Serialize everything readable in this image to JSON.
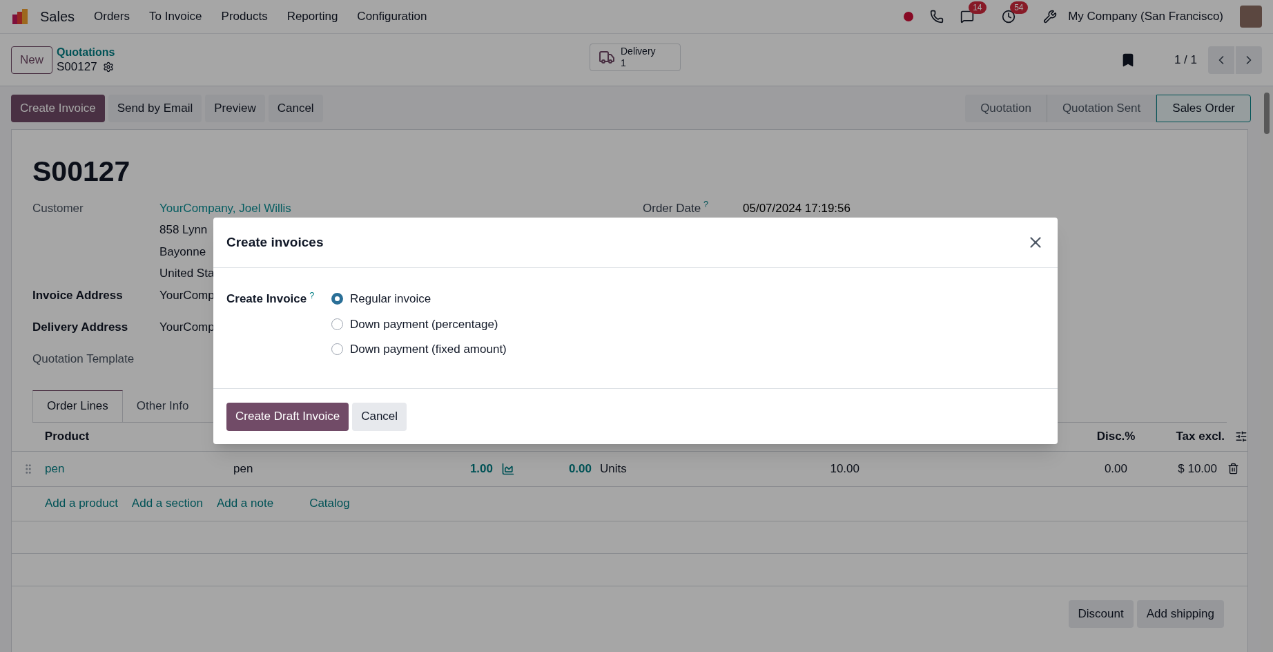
{
  "navbar": {
    "app_name": "Sales",
    "menu": [
      "Orders",
      "To Invoice",
      "Products",
      "Reporting",
      "Configuration"
    ],
    "messages_count": "14",
    "activities_count": "54",
    "company": "My Company (San Francisco)"
  },
  "control_panel": {
    "new_button": "New",
    "breadcrumb_parent": "Quotations",
    "breadcrumb_current": "S00127",
    "smart_button": {
      "label": "Delivery",
      "count": "1"
    },
    "pager": "1 / 1"
  },
  "actions": [
    {
      "label": "Create Invoice",
      "primary": true
    },
    {
      "label": "Send by Email",
      "primary": false
    },
    {
      "label": "Preview",
      "primary": false
    },
    {
      "label": "Cancel",
      "primary": false
    }
  ],
  "statusbar": [
    {
      "label": "Quotation",
      "selected": false
    },
    {
      "label": "Quotation Sent",
      "selected": false
    },
    {
      "label": "Sales Order",
      "selected": true
    }
  ],
  "form": {
    "title": "S00127",
    "customer": {
      "label": "Customer",
      "value": "YourCompany, Joel Willis",
      "address_lines": [
        "858 Lynn",
        "Bayonne",
        "United Sta"
      ]
    },
    "order_date": {
      "label": "Order Date",
      "help_mark": "?",
      "value": "05/07/2024 17:19:56"
    },
    "invoice_address": {
      "label": "Invoice Address",
      "value": "YourComp"
    },
    "delivery_address": {
      "label": "Delivery Address",
      "value": "YourComp"
    },
    "quotation_template": {
      "label": "Quotation Template"
    }
  },
  "tabs": [
    {
      "label": "Order Lines",
      "selected": true
    },
    {
      "label": "Other Info",
      "selected": false
    }
  ],
  "table": {
    "columns": {
      "product": "Product",
      "discount": "Disc.%",
      "subtotal": "Tax excl."
    },
    "rows": [
      {
        "product": "pen",
        "description": "pen",
        "quantity": "1.00",
        "invoiced": "0.00",
        "uom": "Units",
        "unit_price": "10.00",
        "discount": "0.00",
        "subtotal": "$ 10.00"
      }
    ],
    "add_links": [
      "Add a product",
      "Add a section",
      "Add a note",
      "Catalog"
    ]
  },
  "footer_buttons": [
    "Discount",
    "Add shipping"
  ],
  "dialog": {
    "title": "Create invoices",
    "field_label": "Create Invoice",
    "help_mark": "?",
    "options": [
      {
        "label": "Regular invoice",
        "selected": true
      },
      {
        "label": "Down payment (percentage)",
        "selected": false
      },
      {
        "label": "Down payment (fixed amount)",
        "selected": false
      }
    ],
    "buttons": [
      {
        "label": "Create Draft Invoice",
        "primary": true
      },
      {
        "label": "Cancel",
        "primary": false
      }
    ]
  }
}
